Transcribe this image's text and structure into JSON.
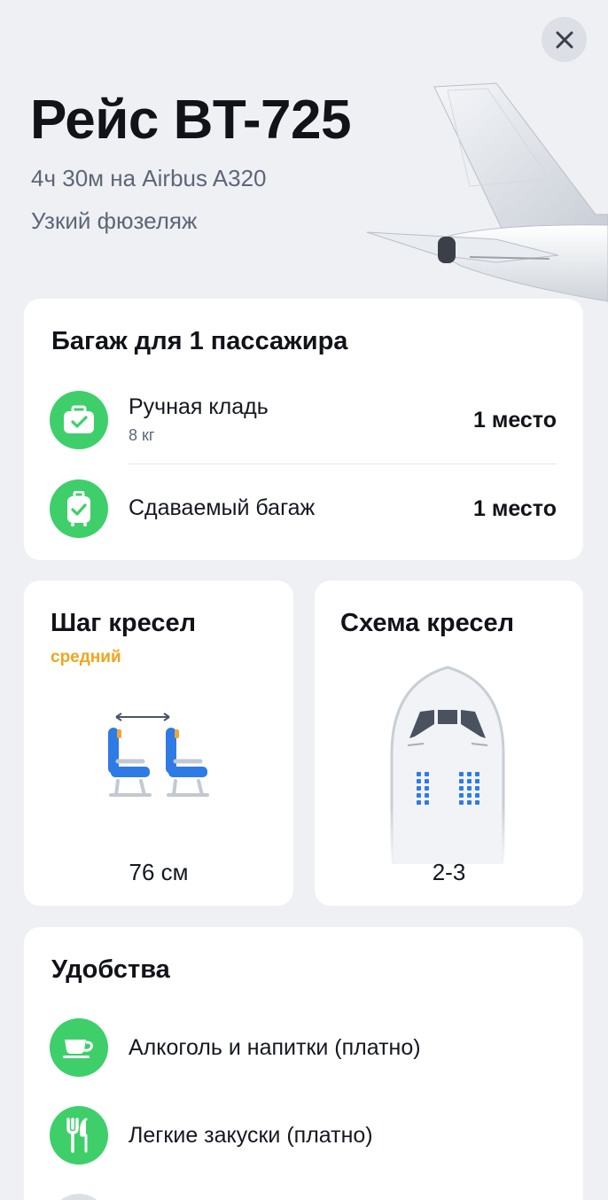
{
  "header": {
    "title": "Рейс BT-725",
    "subtitle": "4ч 30м на Airbus A320",
    "body_type": "Узкий фюзеляж",
    "close_icon": "close-icon"
  },
  "baggage": {
    "title": "Багаж для 1 пассажира",
    "items": [
      {
        "label": "Ручная кладь",
        "detail": "8 кг",
        "value": "1 место",
        "icon": "carry-on-bag-check-icon"
      },
      {
        "label": "Сдаваемый багаж",
        "value": "1 место",
        "icon": "checked-luggage-check-icon"
      }
    ]
  },
  "seat_pitch": {
    "title": "Шаг кресел",
    "level": "средний",
    "value": "76 см",
    "icon": "seat-pitch-icon"
  },
  "seat_layout": {
    "title": "Схема кресел",
    "value": "2-3",
    "icon": "aircraft-nose-seat-map-icon"
  },
  "amenities": {
    "title": "Удобства",
    "items": [
      {
        "label": "Алкоголь и напитки (платно)",
        "icon": "cup-icon"
      },
      {
        "label": "Легкие закуски (платно)",
        "icon": "fork-knife-icon"
      }
    ]
  },
  "colors": {
    "accent_green": "#3ecf6b",
    "level_orange": "#f2a51b",
    "seat_blue": "#2f7be5",
    "background": "#eef0f4"
  }
}
